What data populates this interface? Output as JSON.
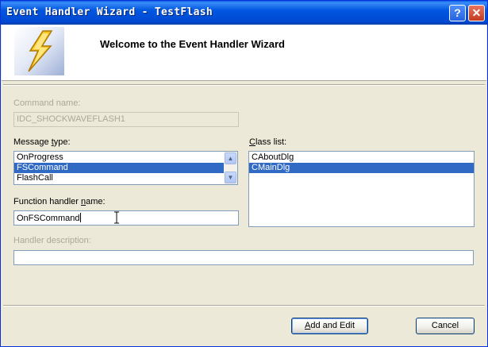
{
  "window": {
    "title": "Event Handler Wizard - TestFlash"
  },
  "titlebar": {
    "help_glyph": "?",
    "close_glyph": "✕"
  },
  "header": {
    "heading": "Welcome to the Event Handler Wizard",
    "logo_icon": "lightning-icon"
  },
  "command": {
    "label": "Command name:",
    "value": "IDC_SHOCKWAVEFLASH1"
  },
  "message_type": {
    "label_pre": "Message ",
    "label_key": "t",
    "label_post": "ype:",
    "items": [
      "OnProgress",
      "FSCommand",
      "FlashCall"
    ],
    "selected_index": 1
  },
  "class_list": {
    "label_pre": "",
    "label_key": "C",
    "label_post": "lass list:",
    "items": [
      "CAboutDlg",
      "CMainDlg"
    ],
    "selected_index": 1
  },
  "function_handler": {
    "label_pre": "Function handler ",
    "label_key": "n",
    "label_post": "ame:",
    "value": "OnFSCommand"
  },
  "handler_description": {
    "label": "Handler description:",
    "value": ""
  },
  "buttons": {
    "add_pre": "",
    "add_key": "A",
    "add_post": "dd and Edit",
    "cancel": "Cancel"
  },
  "colors": {
    "selection": "#316AC5",
    "titlebar": "#0054E3",
    "face": "#ECE9D8"
  }
}
